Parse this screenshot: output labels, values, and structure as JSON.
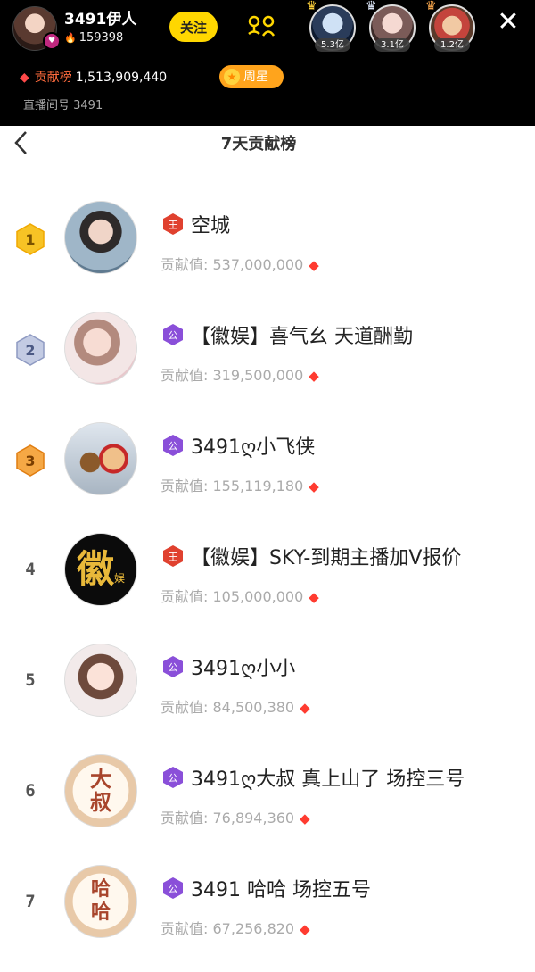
{
  "host": {
    "name": "3491伊人",
    "fans": "159398",
    "follow_label": "关注",
    "contribution_label": "贡献榜",
    "contribution_total": "1,513,909,440",
    "week_star_label": "周星",
    "room_id": "直播间号 3491"
  },
  "top_viewers": [
    {
      "amount": "5.3亿"
    },
    {
      "amount": "3.1亿"
    },
    {
      "amount": "1.2亿"
    }
  ],
  "panel": {
    "title": "7天贡献榜",
    "contrib_prefix": "贡献值:"
  },
  "leaderboard": [
    {
      "rank": "1",
      "tag": "王",
      "name": "空城",
      "value": "537,000,000"
    },
    {
      "rank": "2",
      "tag": "公",
      "name": "【徽娱】喜气幺 天道酬勤",
      "value": "319,500,000"
    },
    {
      "rank": "3",
      "tag": "公",
      "name": "3491ღ小飞侠",
      "value": "155,119,180"
    },
    {
      "rank": "4",
      "tag": "王",
      "name": "【徽娱】SKY-到期主播加V报价",
      "value": "105,000,000"
    },
    {
      "rank": "5",
      "tag": "公",
      "name": "3491ღ小小",
      "value": "84,500,380"
    },
    {
      "rank": "6",
      "tag": "公",
      "name": "3491ღ大叔 真上山了 场控三号",
      "value": "76,894,360"
    },
    {
      "rank": "7",
      "tag": "公",
      "name": "3491 哈哈 场控五号",
      "value": "67,256,820"
    }
  ],
  "avatar_texts": {
    "row4": "徽",
    "row4_small": "娱",
    "row6": "大叔",
    "row7": "哈哈"
  },
  "colors": {
    "accent_yellow": "#ffd700",
    "tag_king": "#e0412f",
    "tag_guild": "#8a4fd9",
    "gem": "#ff3b30",
    "gold_medal": "#f7c325",
    "silver_medal": "#9aa6c8",
    "bronze_medal": "#f29a3a"
  }
}
